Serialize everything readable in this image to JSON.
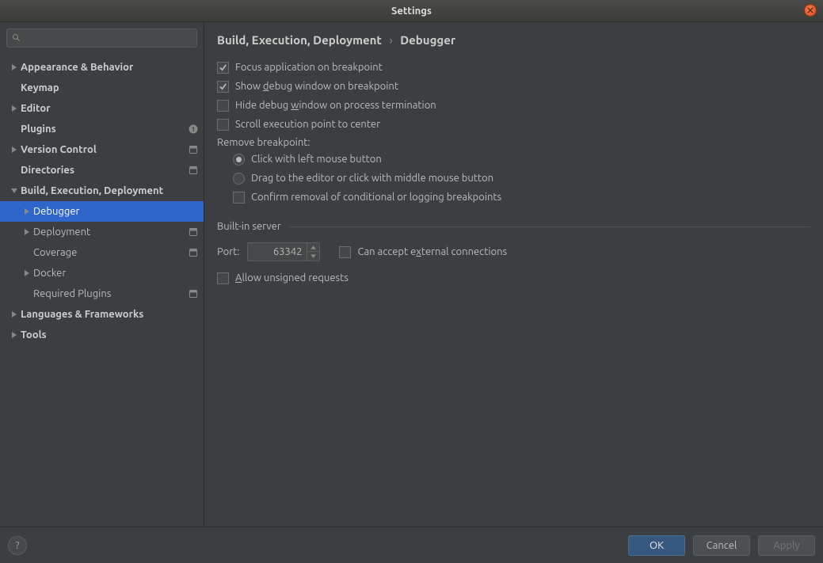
{
  "window": {
    "title": "Settings"
  },
  "search": {
    "placeholder": ""
  },
  "tree": {
    "items": [
      {
        "label": "Appearance & Behavior",
        "arrow": "right",
        "bold": true,
        "indent": 0,
        "badge": ""
      },
      {
        "label": "Keymap",
        "arrow": "",
        "bold": true,
        "indent": 0,
        "badge": ""
      },
      {
        "label": "Editor",
        "arrow": "right",
        "bold": true,
        "indent": 0,
        "badge": ""
      },
      {
        "label": "Plugins",
        "arrow": "",
        "bold": true,
        "indent": 0,
        "badge": "count"
      },
      {
        "label": "Version Control",
        "arrow": "right",
        "bold": true,
        "indent": 0,
        "badge": "profile"
      },
      {
        "label": "Directories",
        "arrow": "",
        "bold": true,
        "indent": 0,
        "badge": "profile"
      },
      {
        "label": "Build, Execution, Deployment",
        "arrow": "down",
        "bold": true,
        "indent": 0,
        "badge": "",
        "expanded": true
      },
      {
        "label": "Debugger",
        "arrow": "right",
        "bold": false,
        "indent": 1,
        "badge": "",
        "selected": true
      },
      {
        "label": "Deployment",
        "arrow": "right",
        "bold": false,
        "indent": 1,
        "badge": "profile"
      },
      {
        "label": "Coverage",
        "arrow": "",
        "bold": false,
        "indent": 1,
        "badge": "profile"
      },
      {
        "label": "Docker",
        "arrow": "right",
        "bold": false,
        "indent": 1,
        "badge": ""
      },
      {
        "label": "Required Plugins",
        "arrow": "",
        "bold": false,
        "indent": 1,
        "badge": "profile"
      },
      {
        "label": "Languages & Frameworks",
        "arrow": "right",
        "bold": true,
        "indent": 0,
        "badge": ""
      },
      {
        "label": "Tools",
        "arrow": "right",
        "bold": true,
        "indent": 0,
        "badge": ""
      }
    ]
  },
  "breadcrumb": {
    "root": "Build, Execution, Deployment",
    "sep": "›",
    "leaf": "Debugger"
  },
  "options": {
    "focus": {
      "label": "Focus application on breakpoint",
      "checked": true
    },
    "showWindow": {
      "pre": "Show ",
      "u": "d",
      "post": "ebug window on breakpoint",
      "checked": true
    },
    "hideWindow": {
      "pre": "Hide debug ",
      "u": "w",
      "post": "indow on process termination",
      "checked": false
    },
    "scroll": {
      "label": "Scroll execution point to center",
      "checked": false
    },
    "removeLabel": "Remove breakpoint:",
    "radioClick": {
      "label": "Click with left mouse button",
      "selected": true
    },
    "radioDrag": {
      "label": "Drag to the editor or click with middle mouse button",
      "selected": false
    },
    "confirm": {
      "label": "Confirm removal of conditional or logging breakpoints",
      "checked": false
    }
  },
  "server": {
    "title": "Built-in server",
    "portLabel": "Port:",
    "port": "63342",
    "external": {
      "pre": "Can accept e",
      "u": "x",
      "post": "ternal connections",
      "checked": false
    },
    "unsigned": {
      "pre": "",
      "u": "A",
      "post": "llow unsigned requests",
      "checked": false
    }
  },
  "footer": {
    "help": "?",
    "ok": "OK",
    "cancel": "Cancel",
    "apply": "Apply"
  }
}
